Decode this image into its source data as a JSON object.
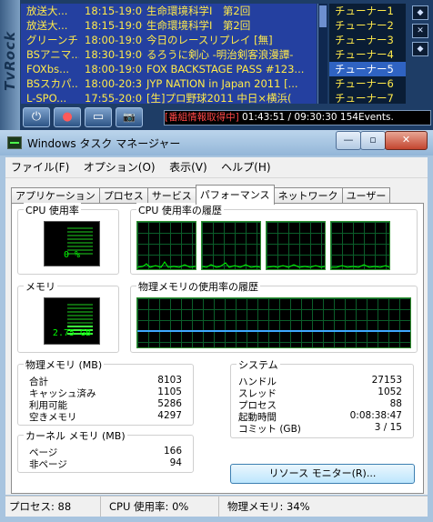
{
  "tvrock": {
    "logo": "TvRock",
    "programs": [
      {
        "channel": "放送大...",
        "time": "18:15-19:00",
        "title": "生命環境科学Ⅰ　第2回"
      },
      {
        "channel": "放送大...",
        "time": "18:15-19:00",
        "title": "生命環境科学Ⅰ　第2回"
      },
      {
        "channel": "グリーンチ...",
        "time": "18:00-19:00",
        "title": "今日のレースリプレイ [無]"
      },
      {
        "channel": "BSアニマ...",
        "time": "18:30-19:00",
        "title": "るろうに剣心 -明治剣客浪漫譚-"
      },
      {
        "channel": "FOXbs...",
        "time": "18:00-19:00",
        "title": "FOX BACKSTAGE PASS #123..."
      },
      {
        "channel": "BSスカパ...",
        "time": "18:00-20:30",
        "title": "JYP NATION in Japan 2011 [..."
      },
      {
        "channel": "L-SPO...",
        "time": "17:55-20:00",
        "title": "[生]プロ野球2011 中日×横浜("
      }
    ],
    "tuners": [
      "チューナー1",
      "チューナー2",
      "チューナー3",
      "チューナー4",
      "チューナー5",
      "チューナー6",
      "チューナー7"
    ],
    "selected_tuner_index": 4,
    "side_buttons": [
      "◆",
      "✕",
      "◆"
    ],
    "controls": [
      "⏻",
      "●",
      "▭",
      "📷"
    ],
    "status_warning": "[番組情報取得中]",
    "status_text": " 01:43:51 / 09:30:30 154Events."
  },
  "taskmgr": {
    "title": "Windows タスク マネージャー",
    "caption": {
      "minimize": "—",
      "maximize": "▫",
      "close": "✕"
    },
    "menu": [
      "ファイル(F)",
      "オプション(O)",
      "表示(V)",
      "ヘルプ(H)"
    ],
    "tabs": [
      "アプリケーション",
      "プロセス",
      "サービス",
      "パフォーマンス",
      "ネットワーク",
      "ユーザー"
    ],
    "active_tab_index": 3,
    "cpu_usage": {
      "label": "CPU 使用率",
      "value": "0 %",
      "fraction": 0.0
    },
    "cpu_history_label": "CPU 使用率の履歴",
    "memory": {
      "label": "メモリ",
      "value": "2.75 GB",
      "fraction": 0.34
    },
    "memory_history_label": "物理メモリの使用率の履歴",
    "physical_memory": {
      "label": "物理メモリ (MB)",
      "rows": [
        {
          "k": "合計",
          "v": "8103"
        },
        {
          "k": "キャッシュ済み",
          "v": "1105"
        },
        {
          "k": "利用可能",
          "v": "5286"
        },
        {
          "k": "空きメモリ",
          "v": "4297"
        }
      ]
    },
    "kernel_memory": {
      "label": "カーネル メモリ (MB)",
      "rows": [
        {
          "k": "ページ",
          "v": "166"
        },
        {
          "k": "非ページ",
          "v": "94"
        }
      ]
    },
    "system": {
      "label": "システム",
      "rows": [
        {
          "k": "ハンドル",
          "v": "27153"
        },
        {
          "k": "スレッド",
          "v": "1052"
        },
        {
          "k": "プロセス",
          "v": "88"
        },
        {
          "k": "起動時間",
          "v": "0:08:38:47"
        },
        {
          "k": "コミット (GB)",
          "v": "3 / 15"
        }
      ]
    },
    "resource_monitor_button": "リソース モニター(R)...",
    "statusbar": {
      "processes": "プロセス: 88",
      "cpu": "CPU 使用率: 0%",
      "memory": "物理メモリ: 34%"
    }
  }
}
